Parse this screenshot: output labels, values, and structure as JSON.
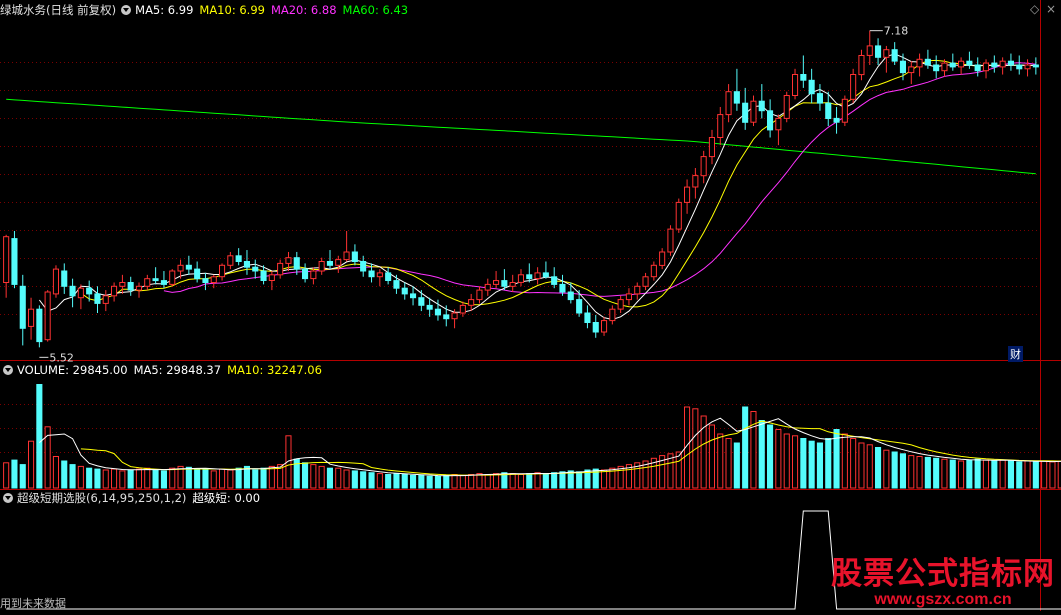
{
  "header": {
    "title": "绿城水务(日线 前复权)",
    "ma5": "MA5: 6.99",
    "ma10": "MA10: 6.99",
    "ma20": "MA20: 6.88",
    "ma60": "MA60: 6.43"
  },
  "volume_header": {
    "label": "VOLUME: 29845.00",
    "ma5": "MA5: 29848.37",
    "ma10": "MA10: 32247.06"
  },
  "indicator_header": {
    "label": "超级短期选股(6,14,95,250,1,2)",
    "value": "超级短: 0.00"
  },
  "badge": "财",
  "footer": "用到未来数据",
  "watermark": {
    "title": "股票公式指标网",
    "url": "www.gszx.com.cn"
  },
  "colors": {
    "up": "#ff3232",
    "down": "#54fcfc",
    "ma5": "#ffffff",
    "ma10": "#ffff00",
    "ma20": "#ff32ff",
    "ma60": "#00ff00",
    "grid": "#7a0000",
    "border": "#b40000"
  },
  "chart_data": [
    {
      "type": "candlestick",
      "x_count": 130,
      "annotations": {
        "high": "7.18",
        "low": "5.52"
      },
      "candles": [
        [
          5.86,
          6.11,
          5.78,
          6.1
        ],
        [
          6.09,
          6.13,
          5.83,
          5.85
        ],
        [
          5.84,
          5.9,
          5.53,
          5.62
        ],
        [
          5.63,
          5.78,
          5.56,
          5.72
        ],
        [
          5.72,
          5.74,
          5.52,
          5.55
        ],
        [
          5.56,
          5.82,
          5.55,
          5.81
        ],
        [
          5.8,
          5.95,
          5.78,
          5.93
        ],
        [
          5.92,
          5.96,
          5.8,
          5.84
        ],
        [
          5.84,
          5.88,
          5.73,
          5.79
        ],
        [
          5.78,
          5.85,
          5.72,
          5.83
        ],
        [
          5.83,
          5.87,
          5.76,
          5.8
        ],
        [
          5.8,
          5.84,
          5.7,
          5.75
        ],
        [
          5.75,
          5.82,
          5.71,
          5.79
        ],
        [
          5.79,
          5.86,
          5.76,
          5.84
        ],
        [
          5.84,
          5.9,
          5.8,
          5.86
        ],
        [
          5.86,
          5.89,
          5.79,
          5.82
        ],
        [
          5.82,
          5.86,
          5.78,
          5.84
        ],
        [
          5.84,
          5.9,
          5.82,
          5.88
        ],
        [
          5.88,
          5.94,
          5.85,
          5.87
        ],
        [
          5.87,
          5.92,
          5.83,
          5.85
        ],
        [
          5.85,
          5.93,
          5.84,
          5.92
        ],
        [
          5.92,
          5.98,
          5.88,
          5.95
        ],
        [
          5.95,
          6.0,
          5.9,
          5.93
        ],
        [
          5.93,
          5.97,
          5.86,
          5.88
        ],
        [
          5.88,
          5.91,
          5.82,
          5.86
        ],
        [
          5.86,
          5.9,
          5.83,
          5.89
        ],
        [
          5.89,
          5.96,
          5.87,
          5.95
        ],
        [
          5.95,
          6.02,
          5.93,
          6.0
        ],
        [
          6.0,
          6.04,
          5.95,
          5.97
        ],
        [
          5.97,
          6.03,
          5.9,
          5.94
        ],
        [
          5.94,
          5.98,
          5.88,
          5.92
        ],
        [
          5.92,
          5.95,
          5.85,
          5.87
        ],
        [
          5.87,
          5.92,
          5.82,
          5.9
        ],
        [
          5.9,
          5.98,
          5.88,
          5.96
        ],
        [
          5.96,
          6.02,
          5.92,
          5.99
        ],
        [
          5.99,
          6.02,
          5.9,
          5.93
        ],
        [
          5.93,
          5.96,
          5.86,
          5.88
        ],
        [
          5.88,
          5.94,
          5.85,
          5.92
        ],
        [
          5.92,
          5.99,
          5.9,
          5.97
        ],
        [
          5.97,
          6.03,
          5.93,
          5.95
        ],
        [
          5.95,
          6.0,
          5.91,
          5.98
        ],
        [
          5.98,
          6.13,
          5.97,
          6.02
        ],
        [
          6.02,
          6.06,
          5.95,
          5.97
        ],
        [
          5.97,
          6.0,
          5.89,
          5.92
        ],
        [
          5.92,
          5.96,
          5.86,
          5.89
        ],
        [
          5.89,
          5.93,
          5.84,
          5.91
        ],
        [
          5.91,
          5.94,
          5.85,
          5.87
        ],
        [
          5.87,
          5.9,
          5.8,
          5.83
        ],
        [
          5.83,
          5.86,
          5.77,
          5.8
        ],
        [
          5.8,
          5.84,
          5.74,
          5.78
        ],
        [
          5.78,
          5.82,
          5.71,
          5.74
        ],
        [
          5.74,
          5.78,
          5.68,
          5.72
        ],
        [
          5.72,
          5.77,
          5.66,
          5.69
        ],
        [
          5.69,
          5.74,
          5.63,
          5.67
        ],
        [
          5.67,
          5.72,
          5.62,
          5.7
        ],
        [
          5.7,
          5.76,
          5.68,
          5.74
        ],
        [
          5.74,
          5.8,
          5.71,
          5.77
        ],
        [
          5.77,
          5.84,
          5.75,
          5.82
        ],
        [
          5.82,
          5.88,
          5.79,
          5.85
        ],
        [
          5.85,
          5.92,
          5.83,
          5.87
        ],
        [
          5.87,
          5.93,
          5.82,
          5.84
        ],
        [
          5.84,
          5.9,
          5.81,
          5.86
        ],
        [
          5.86,
          5.93,
          5.84,
          5.9
        ],
        [
          5.9,
          5.96,
          5.86,
          5.88
        ],
        [
          5.88,
          5.94,
          5.85,
          5.91
        ],
        [
          5.91,
          5.97,
          5.88,
          5.89
        ],
        [
          5.89,
          5.94,
          5.83,
          5.85
        ],
        [
          5.85,
          5.9,
          5.79,
          5.81
        ],
        [
          5.81,
          5.86,
          5.75,
          5.77
        ],
        [
          5.77,
          5.82,
          5.68,
          5.7
        ],
        [
          5.7,
          5.74,
          5.62,
          5.65
        ],
        [
          5.65,
          5.69,
          5.57,
          5.6
        ],
        [
          5.6,
          5.68,
          5.58,
          5.66
        ],
        [
          5.66,
          5.74,
          5.64,
          5.72
        ],
        [
          5.72,
          5.79,
          5.7,
          5.77
        ],
        [
          5.77,
          5.83,
          5.74,
          5.8
        ],
        [
          5.8,
          5.86,
          5.77,
          5.84
        ],
        [
          5.84,
          5.91,
          5.82,
          5.89
        ],
        [
          5.89,
          5.97,
          5.87,
          5.95
        ],
        [
          5.95,
          6.04,
          5.93,
          6.02
        ],
        [
          6.02,
          6.16,
          6.0,
          6.14
        ],
        [
          6.14,
          6.3,
          6.12,
          6.28
        ],
        [
          6.28,
          6.4,
          6.22,
          6.36
        ],
        [
          6.36,
          6.46,
          6.3,
          6.42
        ],
        [
          6.42,
          6.55,
          6.38,
          6.52
        ],
        [
          6.52,
          6.66,
          6.48,
          6.62
        ],
        [
          6.62,
          6.78,
          6.58,
          6.74
        ],
        [
          6.74,
          6.9,
          6.7,
          6.86
        ],
        [
          6.86,
          6.98,
          6.76,
          6.8
        ],
        [
          6.8,
          6.88,
          6.66,
          6.7
        ],
        [
          6.7,
          6.84,
          6.68,
          6.81
        ],
        [
          6.81,
          6.9,
          6.72,
          6.76
        ],
        [
          6.76,
          6.82,
          6.62,
          6.66
        ],
        [
          6.66,
          6.74,
          6.58,
          6.72
        ],
        [
          6.72,
          6.86,
          6.7,
          6.84
        ],
        [
          6.84,
          6.98,
          6.82,
          6.95
        ],
        [
          6.95,
          7.05,
          6.88,
          6.92
        ],
        [
          6.92,
          6.98,
          6.8,
          6.85
        ],
        [
          6.85,
          6.9,
          6.76,
          6.8
        ],
        [
          6.8,
          6.86,
          6.68,
          6.72
        ],
        [
          6.72,
          6.78,
          6.64,
          6.7
        ],
        [
          6.7,
          6.84,
          6.68,
          6.82
        ],
        [
          6.82,
          6.98,
          6.8,
          6.95
        ],
        [
          6.95,
          7.08,
          6.92,
          7.05
        ],
        [
          7.05,
          7.18,
          7.0,
          7.1
        ],
        [
          7.1,
          7.14,
          7.0,
          7.04
        ],
        [
          7.04,
          7.1,
          6.96,
          7.08
        ],
        [
          7.08,
          7.12,
          7.0,
          7.02
        ],
        [
          7.02,
          7.06,
          6.92,
          6.96
        ],
        [
          6.96,
          7.02,
          6.9,
          6.99
        ],
        [
          6.99,
          7.06,
          6.94,
          7.03
        ],
        [
          7.03,
          7.08,
          6.98,
          7.0
        ],
        [
          7.0,
          7.05,
          6.93,
          6.97
        ],
        [
          6.97,
          7.03,
          6.94,
          7.01
        ],
        [
          7.01,
          7.06,
          6.97,
          6.99
        ],
        [
          6.99,
          7.04,
          6.95,
          7.02
        ],
        [
          7.02,
          7.07,
          6.98,
          7.0
        ],
        [
          7.0,
          7.04,
          6.94,
          6.97
        ],
        [
          6.97,
          7.03,
          6.93,
          7.01
        ],
        [
          7.01,
          7.05,
          6.96,
          6.99
        ],
        [
          6.99,
          7.04,
          6.95,
          7.02
        ],
        [
          7.02,
          7.06,
          6.97,
          7.0
        ],
        [
          7.0,
          7.05,
          6.95,
          6.98
        ],
        [
          6.98,
          7.03,
          6.94,
          7.0
        ],
        [
          7.0,
          7.04,
          6.95,
          6.99
        ]
      ],
      "ma60": [
        6.82,
        6.7,
        6.6,
        6.43
      ]
    },
    {
      "type": "bar",
      "name": "volume",
      "ylim": [
        0,
        120000
      ],
      "values": [
        28000,
        31000,
        26000,
        52000,
        115000,
        68000,
        35000,
        30000,
        26000,
        24000,
        22000,
        21000,
        20000,
        21000,
        19000,
        20000,
        21000,
        22000,
        20000,
        19000,
        22000,
        24000,
        23000,
        21000,
        20000,
        19000,
        21000,
        20000,
        22000,
        24000,
        20000,
        22000,
        24000,
        26000,
        58000,
        32000,
        28000,
        26000,
        24000,
        22000,
        22000,
        20000,
        19000,
        18000,
        17000,
        16000,
        15000,
        16000,
        15000,
        14000,
        14000,
        13000,
        13000,
        14000,
        15000,
        14000,
        15000,
        16000,
        15000,
        16000,
        17000,
        16000,
        15000,
        16000,
        17000,
        16000,
        17000,
        18000,
        19000,
        18000,
        20000,
        21000,
        20000,
        22000,
        24000,
        26000,
        28000,
        30000,
        33000,
        36000,
        38000,
        40000,
        90000,
        88000,
        80000,
        70000,
        60000,
        55000,
        50000,
        90000,
        85000,
        75000,
        70000,
        65000,
        60000,
        58000,
        55000,
        52000,
        50000,
        55000,
        65000,
        60000,
        55000,
        50000,
        48000,
        45000,
        42000,
        40000,
        38000,
        36000,
        35000,
        34000,
        33000,
        32000,
        31000,
        30000,
        31000,
        32000,
        31000,
        30000,
        31000,
        30000,
        29000,
        30000,
        29000,
        29845,
        29000,
        30000,
        29000,
        29845
      ]
    },
    {
      "type": "line",
      "name": "超级短",
      "values": [
        0,
        0,
        0,
        0,
        0,
        0,
        0,
        0,
        0,
        0,
        0,
        0,
        0,
        0,
        0,
        0,
        0,
        0,
        0,
        0,
        0,
        0,
        0,
        0,
        0,
        0,
        0,
        0,
        0,
        0,
        0,
        0,
        0,
        0,
        0,
        0,
        0,
        0,
        0,
        0,
        0,
        0,
        0,
        0,
        0,
        0,
        0,
        0,
        0,
        0,
        0,
        0,
        0,
        0,
        0,
        0,
        0,
        0,
        0,
        0,
        0,
        0,
        0,
        0,
        0,
        0,
        0,
        0,
        0,
        0,
        0,
        0,
        0,
        0,
        0,
        0,
        0,
        0,
        0,
        0,
        0,
        0,
        0,
        0,
        0,
        0,
        0,
        0,
        0,
        0,
        0,
        0,
        0,
        0,
        0,
        0,
        1,
        1,
        1,
        1,
        0,
        0,
        0,
        0,
        0,
        0,
        0,
        0,
        0,
        0,
        0,
        0,
        0,
        0,
        0,
        0,
        0,
        0,
        0,
        0,
        0,
        0,
        0,
        0,
        0,
        0,
        0,
        0,
        0,
        0
      ]
    }
  ]
}
